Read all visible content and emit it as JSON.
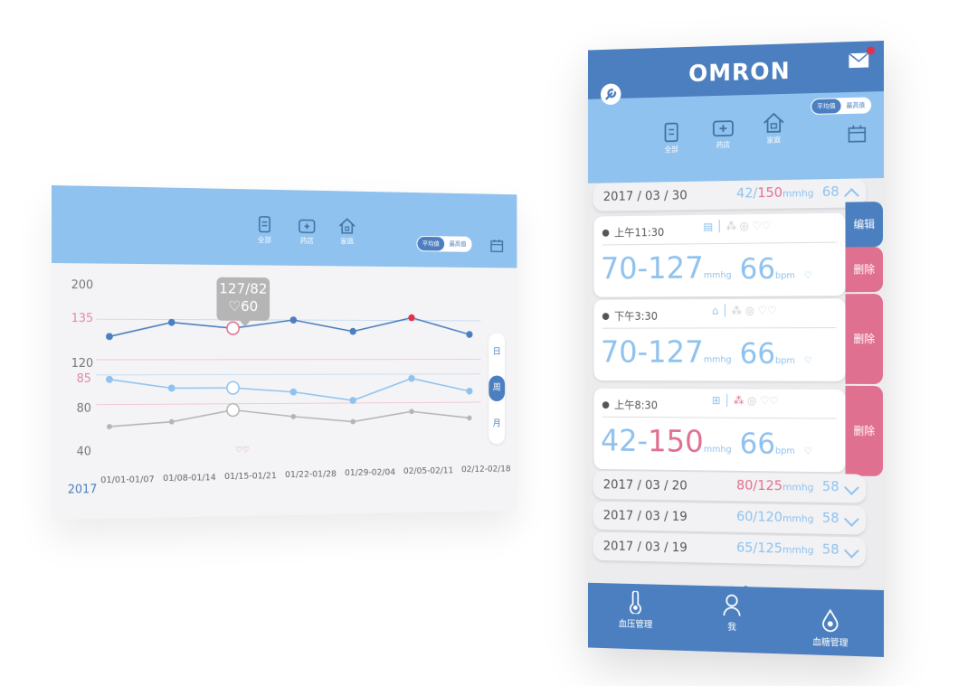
{
  "tablet": {
    "categories": [
      {
        "label": "全部",
        "icon": "document-icon"
      },
      {
        "label": "药店",
        "icon": "medicine-box-icon"
      },
      {
        "label": "家庭",
        "icon": "home-icon"
      }
    ],
    "toggle": {
      "avg": "平均值",
      "max": "最高值"
    },
    "calendar_icon": "calendar-icon",
    "y_labels": {
      "sys_top": "200",
      "sys_line": "135",
      "sys_low": "120",
      "dia_line": "85",
      "dia_low": "80",
      "hr_low": "40"
    },
    "tooltip": {
      "bp": "127/82",
      "hr": "♡60"
    },
    "period": {
      "day": "日",
      "week": "周",
      "month": "月",
      "selected": "week"
    },
    "year": "2017",
    "colors": {
      "bar": "#8fc2ee",
      "dark_blue": "#4c7fbf",
      "light_blue": "#8fc2ee",
      "pink": "#e07090",
      "gray": "#b5b5b5"
    }
  },
  "chart_data": {
    "type": "line",
    "x": [
      "01/01-01/07",
      "01/08-01/14",
      "01/15-01/21",
      "01/22-01/28",
      "01/29-02/04",
      "02/05-02/11",
      "02/12-02/18"
    ],
    "series": [
      {
        "values": [
          129,
          134,
          132,
          135,
          131,
          136,
          130
        ],
        "color": "#4c7fbf"
      },
      {
        "values": [
          84,
          82,
          82,
          81,
          79,
          84,
          81
        ],
        "color": "#8fc2ee"
      },
      {
        "values": [
          49,
          52,
          60,
          55,
          51,
          58,
          53
        ],
        "color": "#b5b5b5"
      }
    ],
    "highlight_index": 2,
    "alert_index": 5,
    "grid": false
  },
  "phone": {
    "logo": "OMRON",
    "toggle": {
      "avg": "平均值",
      "max": "最高值"
    },
    "categories": [
      {
        "label": "全部",
        "icon": "document-icon"
      },
      {
        "label": "药店",
        "icon": "medicine-box-icon"
      },
      {
        "label": "家庭",
        "icon": "home-icon"
      }
    ],
    "day_header": {
      "date": "2017 / 03 / 30",
      "low": "42/",
      "high": "150",
      "unit": "mmhg",
      "hr": "68"
    },
    "entries": [
      {
        "time": "上午11:30",
        "bp_low": "70-127",
        "bp_high": "",
        "unit": "mmhg",
        "hr": "66",
        "hr_unit": "bpm",
        "action_edit": "编辑",
        "action_delete": "删除"
      },
      {
        "time": "下午3:30",
        "bp_low": "70-127",
        "bp_high": "",
        "unit": "mmhg",
        "hr": "66",
        "hr_unit": "bpm",
        "action_delete": "删除"
      },
      {
        "time": "上午8:30",
        "bp_low": "42-",
        "bp_high": "150",
        "unit": "mmhg",
        "hr": "66",
        "hr_unit": "bpm",
        "action_delete": "删除"
      }
    ],
    "collapsed": [
      {
        "date": "2017 / 03 / 20",
        "value": "80/125",
        "pink": true,
        "unit": "mmhg",
        "hr": "58"
      },
      {
        "date": "2017 / 03 / 19",
        "value": "60/120",
        "pink": false,
        "unit": "mmhg",
        "hr": "58"
      },
      {
        "date": "2017 / 03 / 19",
        "value": "65/125",
        "pink": false,
        "unit": "mmhg",
        "hr": "58"
      }
    ],
    "tabs": [
      {
        "label": "血压管理",
        "icon": "thermometer-icon"
      },
      {
        "label": "我",
        "icon": "person-icon"
      },
      {
        "label": "血糖管理",
        "icon": "blood-drop-icon"
      }
    ]
  }
}
